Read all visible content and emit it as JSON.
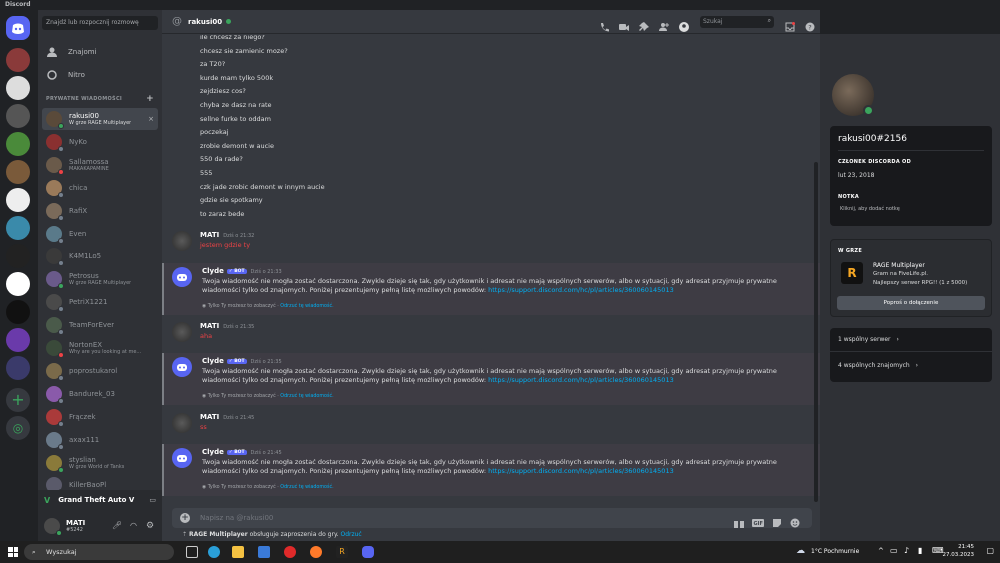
{
  "app": {
    "title": "Discord"
  },
  "dm_sidebar": {
    "search_placeholder": "Znajdź lub rozpocznij rozmowę",
    "nav": [
      {
        "label": "Znajomi"
      },
      {
        "label": "Nitro"
      }
    ],
    "section_title": "PRYWATNE WIADOMOŚCI",
    "dms": [
      {
        "name": "rakusi00",
        "sub": "W grze RAGE Multiplayer",
        "active": true,
        "color": "#5a4a3a",
        "status": "#3ba55d"
      },
      {
        "name": "NyKo",
        "sub": "",
        "color": "#8a3030",
        "status": "#747f8d"
      },
      {
        "name": "Sallamossa",
        "sub": "MAKAKAPAMINE",
        "color": "#6a5a4a",
        "status": "#ed4245"
      },
      {
        "name": "chica",
        "sub": "",
        "color": "#9a7a5a",
        "status": "#747f8d"
      },
      {
        "name": "RafiX",
        "sub": "",
        "color": "#7a6a5a",
        "status": "#747f8d"
      },
      {
        "name": "Even",
        "sub": "",
        "color": "#5a7a8a",
        "status": "#747f8d"
      },
      {
        "name": "K4M1Lo5",
        "sub": "",
        "color": "#3a3a3a",
        "status": "#747f8d"
      },
      {
        "name": "Petrosus",
        "sub": "W grze RAGE Multiplayer",
        "color": "#6a5a8a",
        "status": "#3ba55d"
      },
      {
        "name": "PetriX1221",
        "sub": "",
        "color": "#4a4a4a",
        "status": "#747f8d"
      },
      {
        "name": "TeamForEver",
        "sub": "",
        "color": "#4a5a4a",
        "status": "#747f8d"
      },
      {
        "name": "NortonEX",
        "sub": "Why are you looking at me...",
        "color": "#3a4a3a",
        "status": "#ed4245"
      },
      {
        "name": "poprostukarol",
        "sub": "",
        "color": "#7a6a4a",
        "status": "#747f8d"
      },
      {
        "name": "Bandurek_03",
        "sub": "",
        "color": "#8a5aaa",
        "status": "#747f8d"
      },
      {
        "name": "Frączek",
        "sub": "",
        "color": "#aa3a3a",
        "status": "#747f8d"
      },
      {
        "name": "axax111",
        "sub": "",
        "color": "#6a7a8a",
        "status": "#747f8d"
      },
      {
        "name": "styslian",
        "sub": "W grze World of Tanks",
        "color": "#8a7a3a",
        "status": "#3ba55d"
      },
      {
        "name": "KillerBaoPl",
        "sub": "",
        "color": "#5a5a6a",
        "status": "#747f8d"
      }
    ],
    "game_activity": "Grand Theft Auto V",
    "user": {
      "name": "MATI",
      "tag": "#5242"
    }
  },
  "chat": {
    "recipient": "rakusi00",
    "search_placeholder": "Szukaj",
    "plain_lines": [
      "ile chcesz za niego?",
      "chcesz sie zamienic moze?",
      "za T20?",
      "kurde mam tylko 500k",
      "zejdziesz cos?",
      "chyba ze dasz na rate",
      "sellne furke to oddam",
      "poczekaj",
      "zrobie demont w aucie",
      "550 da rade?",
      "555",
      "czk jade zrobic demont w innym aucie",
      "gdzie sie spotkamy",
      "to zaraz bede"
    ],
    "groups": [
      {
        "author": "MATI",
        "time": "Dziś o 21:32",
        "text": "jestem gdzie ty",
        "bot": false
      },
      {
        "author": "Clyde",
        "badge": "✓ BOT",
        "time": "Dziś o 21:33",
        "text": "Twoja wiadomość nie mogła zostać dostarczona. Zwykle dzieje się tak, gdy użytkownik i adresat nie mają wspólnych serwerów, albo w sytuacji, gdy adresat przyjmuje prywatne wiadomości tylko od znajomych. Poniżej prezentujemy pełną listę możliwych powodów:",
        "link": "https://support.discord.com/hc/pl/articles/360060145013",
        "ephemeral": "Tylko Ty możesz to zobaczyć",
        "dismiss": "Odrzuć tę wiadomość.",
        "bot": true
      },
      {
        "author": "MATI",
        "time": "Dziś o 21:35",
        "text": "aha",
        "bot": false
      },
      {
        "author": "Clyde",
        "badge": "✓ BOT",
        "time": "Dziś o 21:35",
        "text": "Twoja wiadomość nie mogła zostać dostarczona. Zwykle dzieje się tak, gdy użytkownik i adresat nie mają wspólnych serwerów, albo w sytuacji, gdy adresat przyjmuje prywatne wiadomości tylko od znajomych. Poniżej prezentujemy pełną listę możliwych powodów:",
        "link": "https://support.discord.com/hc/pl/articles/360060145013",
        "ephemeral": "Tylko Ty możesz to zobaczyć",
        "dismiss": "Odrzuć tę wiadomość.",
        "bot": true
      },
      {
        "author": "MATI",
        "time": "Dziś o 21:45",
        "text": "ss",
        "bot": false
      },
      {
        "author": "Clyde",
        "badge": "✓ BOT",
        "time": "Dziś o 21:45",
        "text": "Twoja wiadomość nie mogła zostać dostarczona. Zwykle dzieje się tak, gdy użytkownik i adresat nie mają wspólnych serwerów, albo w sytuacji, gdy adresat przyjmuje prywatne wiadomości tylko od znajomych. Poniżej prezentujemy pełną listę możliwych powodów:",
        "link": "https://support.discord.com/hc/pl/articles/360060145013",
        "ephemeral": "Tylko Ty możesz to zobaczyć",
        "dismiss": "Odrzuć tę wiadomość.",
        "bot": true
      }
    ],
    "composer_placeholder": "Napisz na @rakusi00",
    "notice_bold": "RAGE Multiplayer",
    "notice_text": "obsługuje zaproszenia do gry.",
    "notice_link": "Odrzuć"
  },
  "profile": {
    "username": "rakusi00#2156",
    "member_title": "CZŁONEK DISCORDA OD",
    "member_since": "lut 23, 2018",
    "note_title": "NOTKA",
    "note_placeholder": "Kliknij, aby dodać notkę",
    "game_title": "W GRZE",
    "game_name": "RAGE Multiplayer",
    "game_detail1": "Gram na FiveLife.pl.",
    "game_detail2": "Najlepszy serwer RPG!! (1 z 5000)",
    "join_button": "Poproś o dołączenie",
    "mutual_servers": "1 wspólny serwer",
    "mutual_friends": "4 wspólnych znajomych"
  },
  "taskbar": {
    "search": "Wyszukaj",
    "weather": "1°C Pochmurnie",
    "time": "21:45",
    "date": "27.03.2023"
  }
}
